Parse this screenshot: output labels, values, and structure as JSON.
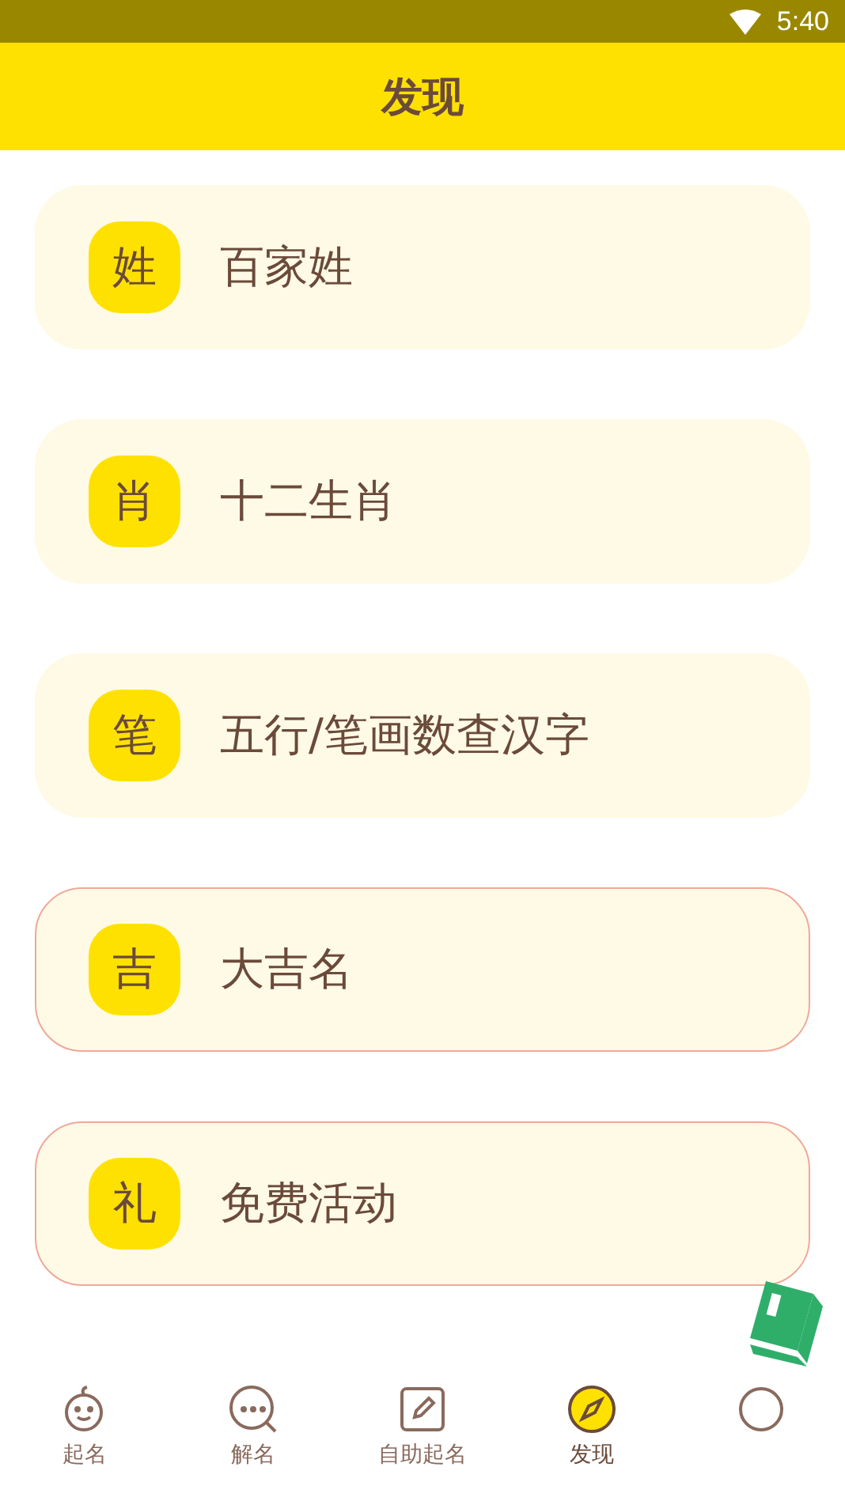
{
  "status_bar": {
    "time": "5:40"
  },
  "header": {
    "title": "发现"
  },
  "items": [
    {
      "badge": "姓",
      "label": "百家姓",
      "outlined": false
    },
    {
      "badge": "肖",
      "label": "十二生肖",
      "outlined": false
    },
    {
      "badge": "笔",
      "label": "五行/笔画数查汉字",
      "outlined": false
    },
    {
      "badge": "吉",
      "label": "大吉名",
      "outlined": true
    },
    {
      "badge": "礼",
      "label": "免费活动",
      "outlined": true
    }
  ],
  "tabs": [
    {
      "kind": "baby",
      "label": "起名",
      "selected": false
    },
    {
      "kind": "chat",
      "label": "解名",
      "selected": false
    },
    {
      "kind": "edit",
      "label": "自助起名",
      "selected": false
    },
    {
      "kind": "compass",
      "label": "发现",
      "selected": true
    },
    {
      "kind": "person",
      "selected": false
    }
  ]
}
